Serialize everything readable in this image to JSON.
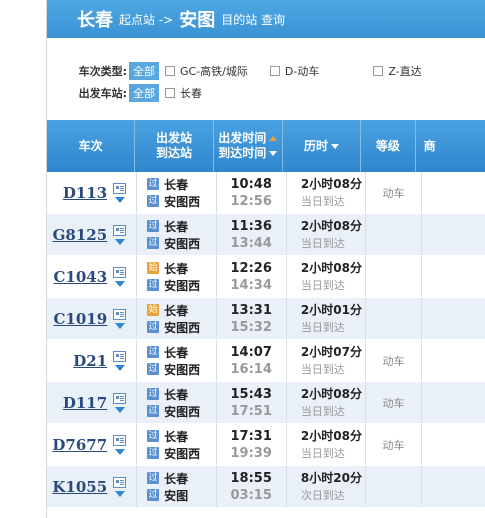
{
  "topbar": {
    "from": "长春",
    "from_label": "起点站 ->",
    "to": "安图",
    "to_label": "目的站 查询"
  },
  "filters": {
    "type_label": "车次类型:",
    "station_label": "出发车站:",
    "all_label": "全部",
    "types": [
      "GC-高铁/城际",
      "D-动车",
      "Z-直达"
    ],
    "stations": [
      "长春"
    ]
  },
  "header": {
    "col1": "车次",
    "col2a": "出发站",
    "col2b": "到达站",
    "col3a": "出发时间",
    "col3b": "到达时间",
    "col4": "历时",
    "col5": "等级",
    "col6": "商"
  },
  "badges": {
    "pass": "过",
    "start": "始"
  },
  "trains": [
    {
      "no": "D113",
      "from": "长春",
      "to": "安图西",
      "dep": "10:48",
      "arr": "12:56",
      "dur": "2小时08分",
      "day": "当日到达",
      "grade": "动车"
    },
    {
      "no": "G8125",
      "from": "长春",
      "to": "安图西",
      "dep": "11:36",
      "arr": "13:44",
      "dur": "2小时08分",
      "day": "当日到达",
      "grade": ""
    },
    {
      "no": "C1043",
      "from": "长春",
      "to": "安图西",
      "dep": "12:26",
      "arr": "14:34",
      "dur": "2小时08分",
      "day": "当日到达",
      "grade": ""
    },
    {
      "no": "C1019",
      "from": "长春",
      "to": "安图西",
      "dep": "13:31",
      "arr": "15:32",
      "dur": "2小时01分",
      "day": "当日到达",
      "grade": ""
    },
    {
      "no": "D21",
      "from": "长春",
      "to": "安图西",
      "dep": "14:07",
      "arr": "16:14",
      "dur": "2小时07分",
      "day": "当日到达",
      "grade": "动车"
    },
    {
      "no": "D117",
      "from": "长春",
      "to": "安图西",
      "dep": "15:43",
      "arr": "17:51",
      "dur": "2小时08分",
      "day": "当日到达",
      "grade": "动车"
    },
    {
      "no": "D7677",
      "from": "长春",
      "to": "安图西",
      "dep": "17:31",
      "arr": "19:39",
      "dur": "2小时08分",
      "day": "当日到达",
      "grade": "动车"
    },
    {
      "no": "K1055",
      "from": "长春",
      "to": "安图",
      "dep": "18:55",
      "arr": "03:15",
      "dur": "8小时20分",
      "day": "次日到达",
      "grade": ""
    }
  ]
}
